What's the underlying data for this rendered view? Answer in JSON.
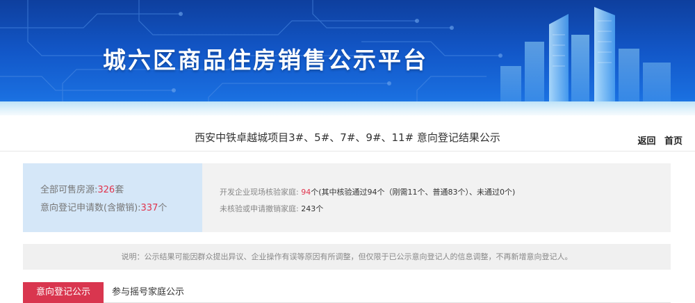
{
  "banner": {
    "title": "城六区商品住房销售公示平台"
  },
  "header": {
    "page_title": "西安中铁卓越城项目3#、5#、7#、9#、11# 意向登记结果公示",
    "back_link": "返回",
    "home_link": "首页"
  },
  "stats": {
    "total_label": "全部可售房源:",
    "total_value": "326",
    "total_unit": "套",
    "applications_label": "意向登记申请数(含撤销):",
    "applications_value": "337",
    "applications_unit": "个",
    "verified_label": "开发企业现场核验家庭:",
    "verified_value": "94",
    "verified_unit": "个",
    "verified_detail": "(其中核验通过94个（刚需11个、普通83个）、未通过0个)",
    "unverified_label": "未核验或申请撤销家庭:",
    "unverified_value": "243个"
  },
  "notice": {
    "text": "说明：公示结果可能因群众提出异议、企业操作有误等原因有所调整，但仅限于已公示意向登记人的信息调整，不再新增意向登记人。"
  },
  "tabs": [
    {
      "label": "意向登记公示",
      "active": true
    },
    {
      "label": "参与摇号家庭公示",
      "active": false
    }
  ],
  "colors": {
    "accent_red": "#d9364f",
    "banner_blue": "#1257c8",
    "panel_blue": "#d5e7f8"
  }
}
